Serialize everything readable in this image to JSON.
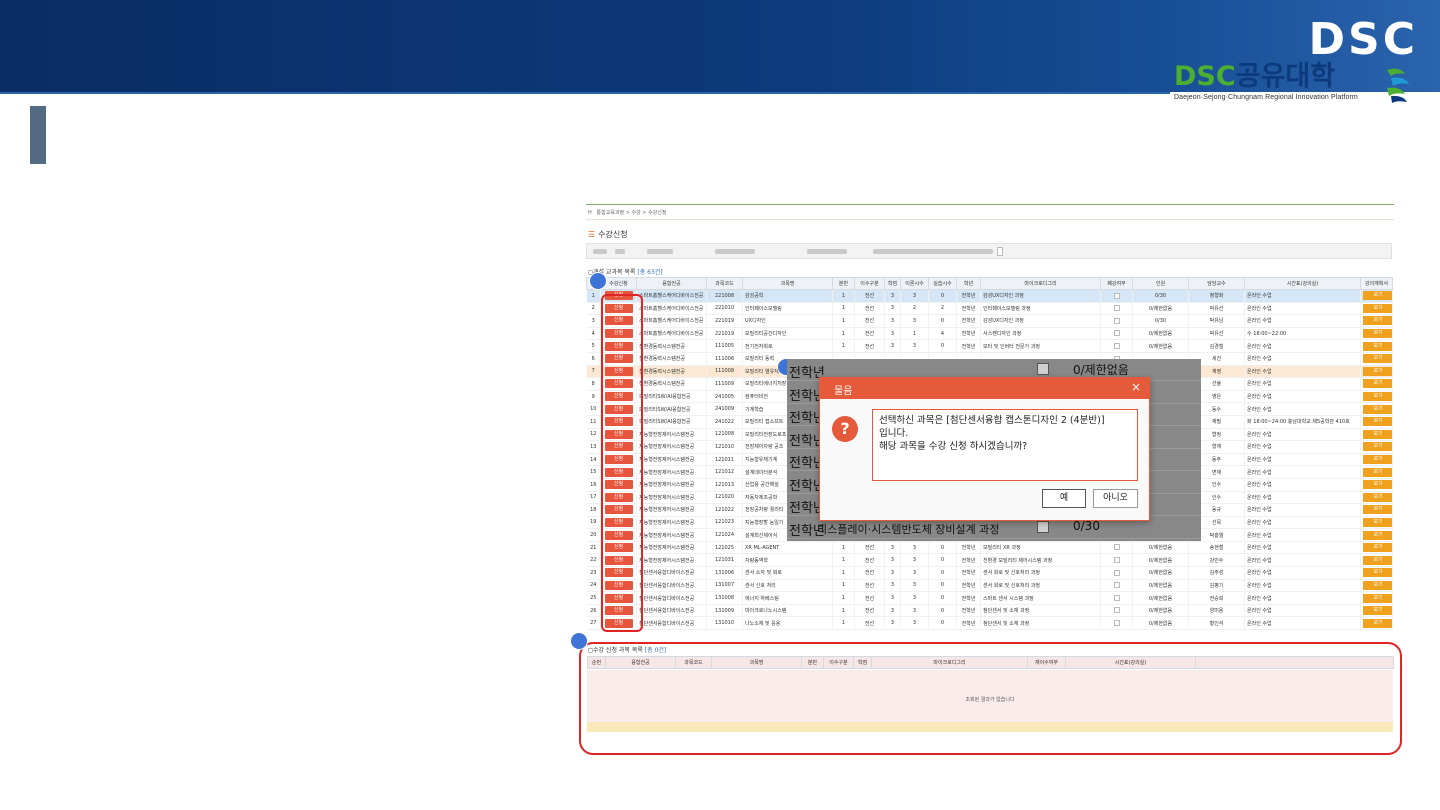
{
  "banner": {
    "logo_top": "DSC",
    "logo_latin": "DSC",
    "logo_korean": "공유대학",
    "logo_sub": "Daejeon·Sejong·Chungnam Regional Innovation Platform",
    "colors": {
      "banner": "#0c3a7c",
      "logo_green": "#4caf2f",
      "accent_red": "#e02424",
      "dialog": "#e45a3a"
    }
  },
  "screen": {
    "breadcrumb": "통합교육과정 > 수강 > 수강신청",
    "title_icon": "list-icon",
    "title": "수강신청",
    "section1": {
      "label": "개설 교과목 목록",
      "count": "[총 63건]"
    },
    "headers": [
      "",
      "수강신청",
      "융합전공",
      "과목코드",
      "과목명",
      "분반",
      "이수구분",
      "학점",
      "이론시수",
      "실습시수",
      "학년",
      "마이크로디그리",
      "폐강여부",
      "인원",
      "담당교수",
      "시간표(강의실)",
      "강의계획서"
    ],
    "apply_label": "신청",
    "view_label": "보기",
    "rows": [
      {
        "n": "1",
        "m": "스마트홈헬스케어디바이스전공",
        "c": "221008",
        "s": "감성공학",
        "b": "1",
        "g": "전선",
        "h": "3",
        "t": "3",
        "p": "0",
        "y": "전학년",
        "md": "감성UX디자인 과정",
        "cnt": "0/30",
        "prof": "정형화",
        "tt": "온라인 수업"
      },
      {
        "n": "2",
        "m": "스마트홈헬스케어디바이스전공",
        "c": "221010",
        "s": "인터페이스모델링",
        "b": "1",
        "g": "전선",
        "h": "3",
        "t": "2",
        "p": "2",
        "y": "전학년",
        "md": "인터페이스모델링 과정",
        "cnt": "0/제한없음",
        "prof": "박유선",
        "tt": "온라인 수업"
      },
      {
        "n": "3",
        "m": "스마트홈헬스케어디바이스전공",
        "c": "221019",
        "s": "UX디자인",
        "b": "1",
        "g": "전선",
        "h": "3",
        "t": "3",
        "p": "0",
        "y": "전학년",
        "md": "감성UX디자인 과정",
        "cnt": "0/30",
        "prof": "박유남",
        "tt": "온라인 수업"
      },
      {
        "n": "4",
        "m": "스마트홈헬스케어디바이스전공",
        "c": "221019",
        "s": "모빌리티공간디자인",
        "b": "1",
        "g": "전선",
        "h": "3",
        "t": "1",
        "p": "4",
        "y": "전학년",
        "md": "서스펜디자인 과정",
        "cnt": "0/제한없음",
        "prof": "박유선",
        "tt": "수 18:00~22:00"
      },
      {
        "n": "5",
        "m": "친환경동력시스템전공",
        "c": "111005",
        "s": "전기전자회로",
        "b": "1",
        "g": "전선",
        "h": "3",
        "t": "3",
        "p": "0",
        "y": "전학년",
        "md": "모터 및 인버터 전문가 과정",
        "cnt": "0/제한없음",
        "prof": "김경철",
        "tt": "온라인 수업"
      },
      {
        "n": "6",
        "m": "친환경동력시스템전공",
        "c": "111006",
        "s": "모빌리티 동력",
        "b": "",
        "g": "",
        "h": "",
        "t": "",
        "p": "",
        "y": "",
        "md": "",
        "cnt": "",
        "prof": "세건",
        "tt": "온라인 수업"
      },
      {
        "n": "7",
        "m": "친환경동력시스템전공",
        "c": "111008",
        "s": "모빌리티 열유체",
        "b": "",
        "g": "",
        "h": "",
        "t": "",
        "p": "",
        "y": "",
        "md": "",
        "cnt": "",
        "prof": "재영",
        "tt": "온라인 수업"
      },
      {
        "n": "8",
        "m": "친환경동력시스템전공",
        "c": "111009",
        "s": "모빌리티에너지저장",
        "b": "",
        "g": "",
        "h": "",
        "t": "",
        "p": "",
        "y": "",
        "md": "",
        "cnt": "",
        "prof": "선율",
        "tt": "온라인 수업"
      },
      {
        "n": "9",
        "m": "모빌리티SW/AI융합전공",
        "c": "241005",
        "s": "컴퓨터비전",
        "b": "",
        "g": "",
        "h": "",
        "t": "",
        "p": "",
        "y": "",
        "md": "",
        "cnt": "",
        "prof": "영은",
        "tt": "온라인 수업"
      },
      {
        "n": "10",
        "m": "모빌리티SW/AI융합전공",
        "c": "241009",
        "s": "기계학습",
        "b": "",
        "g": "",
        "h": "",
        "t": "",
        "p": "",
        "y": "",
        "md": "",
        "cnt": "",
        "prof": "동수",
        "tt": "온라인 수업"
      },
      {
        "n": "11",
        "m": "모빌리티SW/AI융합전공",
        "c": "241022",
        "s": "모빌리티 접소프트",
        "b": "",
        "g": "",
        "h": "",
        "t": "",
        "p": "",
        "y": "",
        "md": "",
        "cnt": "",
        "prof": "재필",
        "tt": "화 18:00~24:00 충남대학교 제5공학관 410호"
      },
      {
        "n": "12",
        "m": "지능형전장제어시스템전공",
        "c": "121008",
        "s": "모빌리티전장도로프",
        "b": "",
        "g": "",
        "h": "",
        "t": "",
        "p": "",
        "y": "",
        "md": "",
        "cnt": "",
        "prof": "형정",
        "tt": "온라인 수업"
      },
      {
        "n": "13",
        "m": "지능형전장제어시스템전공",
        "c": "121010",
        "s": "전장제어차량 공조",
        "b": "",
        "g": "",
        "h": "",
        "t": "",
        "p": "",
        "y": "",
        "md": "",
        "cnt": "",
        "prof": "형재",
        "tt": "온라인 수업"
      },
      {
        "n": "14",
        "m": "지능형전장제어시스템전공",
        "c": "121011",
        "s": "지능형유체기계",
        "b": "",
        "g": "",
        "h": "",
        "t": "",
        "p": "",
        "y": "",
        "md": "",
        "cnt": "",
        "prof": "동주",
        "tt": "온라인 수업"
      },
      {
        "n": "15",
        "m": "지능형전장제어시스템전공",
        "c": "121012",
        "s": "설계데이터분석",
        "b": "",
        "g": "",
        "h": "",
        "t": "",
        "p": "",
        "y": "",
        "md": "",
        "cnt": "",
        "prof": "면재",
        "tt": "온라인 수업"
      },
      {
        "n": "16",
        "m": "지능형전장제어시스템전공",
        "c": "121013",
        "s": "산업용 공간해설",
        "b": "",
        "g": "",
        "h": "",
        "t": "",
        "p": "",
        "y": "",
        "md": "",
        "cnt": "",
        "prof": "인수",
        "tt": "온라인 수업"
      },
      {
        "n": "17",
        "m": "지능형전장제어시스템전공",
        "c": "121020",
        "s": "자동차제조공학",
        "b": "",
        "g": "",
        "h": "",
        "t": "",
        "p": "",
        "y": "",
        "md": "",
        "cnt": "",
        "prof": "인수",
        "tt": "온라인 수업"
      },
      {
        "n": "18",
        "m": "지능형전장제어시스템전공",
        "c": "121022",
        "s": "전장공차량 퀄리티",
        "b": "",
        "g": "",
        "h": "",
        "t": "",
        "p": "",
        "y": "",
        "md": "",
        "cnt": "",
        "prof": "동규",
        "tt": "온라인 수업"
      },
      {
        "n": "19",
        "m": "지능형전장제어시스템전공",
        "c": "121023",
        "s": "지능형장할 능일기",
        "b": "",
        "g": "",
        "h": "",
        "t": "",
        "p": "",
        "y": "",
        "md": "",
        "cnt": "",
        "prof": "선목",
        "tt": "온라인 수업"
      },
      {
        "n": "20",
        "m": "지능형전장제어시스템전공",
        "c": "121024",
        "s": "설계최신제어식",
        "b": "1",
        "g": "전선",
        "h": "3",
        "t": "3",
        "p": "0",
        "y": "전학년",
        "md": "모빌리티 설계제어기 과정",
        "cnt": "0/제한없음",
        "prof": "박흥열",
        "tt": "온라인 수업"
      },
      {
        "n": "21",
        "m": "지능형전장제어시스템전공",
        "c": "121025",
        "s": "XR ML-AGENT",
        "b": "1",
        "g": "전선",
        "h": "3",
        "t": "3",
        "p": "0",
        "y": "전학년",
        "md": "모빌리티 XR 과정",
        "cnt": "0/제한없음",
        "prof": "송현철",
        "tt": "온라인 수업"
      },
      {
        "n": "22",
        "m": "지능형전장제어시스템전공",
        "c": "121031",
        "s": "차량동역학",
        "b": "1",
        "g": "전선",
        "h": "3",
        "t": "3",
        "p": "0",
        "y": "전학년",
        "md": "친환경 모빌리티 제어시스템 과정",
        "cnt": "0/제한없음",
        "prof": "강민수",
        "tt": "온라인 수업"
      },
      {
        "n": "23",
        "m": "첨단센서융합디바이스전공",
        "c": "131006",
        "s": "센서 소자 및 회로",
        "b": "1",
        "g": "전선",
        "h": "3",
        "t": "3",
        "p": "0",
        "y": "전학년",
        "md": "센서 회로 및 신호처리 과정",
        "cnt": "0/제한없음",
        "prof": "김주성",
        "tt": "온라인 수업"
      },
      {
        "n": "24",
        "m": "첨단센서융합디바이스전공",
        "c": "131007",
        "s": "센서 신호 처리",
        "b": "1",
        "g": "전선",
        "h": "3",
        "t": "3",
        "p": "0",
        "y": "전학년",
        "md": "센서 회로 및 신호처리 과정",
        "cnt": "0/제한없음",
        "prof": "김평기",
        "tt": "온라인 수업"
      },
      {
        "n": "25",
        "m": "첨단센서융합디바이스전공",
        "c": "131008",
        "s": "에너지 하베스팅",
        "b": "1",
        "g": "전선",
        "h": "3",
        "t": "3",
        "p": "0",
        "y": "전학년",
        "md": "스마트 센서 시스템 과정",
        "cnt": "0/제한없음",
        "prof": "전승희",
        "tt": "온라인 수업"
      },
      {
        "n": "26",
        "m": "첨단센서융합디바이스전공",
        "c": "131009",
        "s": "마이크로나노시스템",
        "b": "1",
        "g": "전선",
        "h": "3",
        "t": "3",
        "p": "0",
        "y": "전학년",
        "md": "첨단센서 및 소재 과정",
        "cnt": "0/제한없음",
        "prof": "양미용",
        "tt": "온라인 수업"
      },
      {
        "n": "27",
        "m": "첨단센서융합디바이스전공",
        "c": "131010",
        "s": "나노소재 및 응용",
        "b": "1",
        "g": "전선",
        "h": "3",
        "t": "3",
        "p": "0",
        "y": "전학년",
        "md": "첨단센서 및 소재 과정",
        "cnt": "0/제한없음",
        "prof": "황인석",
        "tt": "온라인 수업"
      }
    ],
    "section2": {
      "label": "수강 신청 과목 목록",
      "count": "[총 0건]"
    },
    "headers2": [
      "순번",
      "융합전공",
      "과목코드",
      "과목명",
      "분반",
      "이수구분",
      "학점",
      "마이크로디그리",
      "재이수여부",
      "시간표(강의실)",
      ""
    ],
    "empty_message": "조회된 결과가 없습니다"
  },
  "zoom": {
    "rows": [
      {
        "a": "전학년",
        "b": "",
        "d": "0/제한없음"
      },
      {
        "a": "전학년",
        "b": "",
        "d": ""
      },
      {
        "a": "전학년",
        "b": "",
        "d": ""
      },
      {
        "a": "전학년",
        "b": "",
        "d": ""
      },
      {
        "a": "전학년",
        "b": "",
        "d": ""
      },
      {
        "a": "전학년",
        "b": "",
        "d": ""
      },
      {
        "a": "전학년",
        "b": "",
        "d": ""
      },
      {
        "a": "전학년",
        "b": "디스플레이·시스템반도체 장비설계 과정",
        "d": "0/30"
      }
    ]
  },
  "dialog": {
    "title": "물음",
    "close": "×",
    "line1": "선택하신 과목은 [첨단센서융합 캡스톤디자인 2 (4분반)]",
    "line2": "입니다.",
    "line3": "해당 과목을 수강 신청 하시겠습니까?",
    "yes": "예",
    "no": "아니오"
  }
}
